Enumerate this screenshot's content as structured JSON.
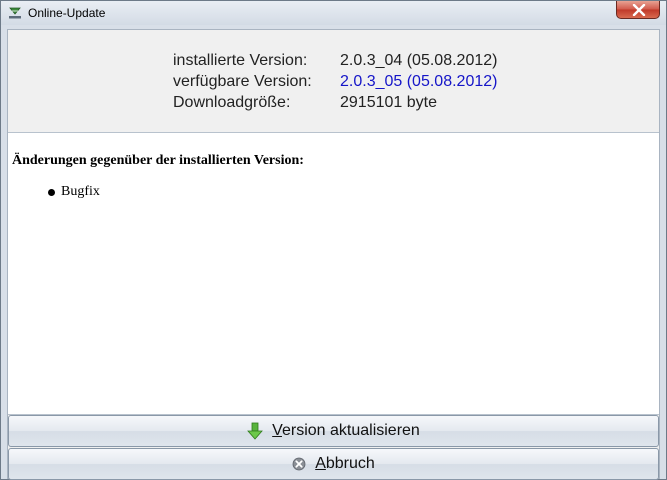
{
  "window": {
    "title": "Online-Update"
  },
  "info": {
    "installed_label": "installierte Version:",
    "installed_value": "2.0.3_04 (05.08.2012)",
    "available_label": "verfügbare Version:",
    "available_value": "2.0.3_05 (05.08.2012)",
    "download_label": "Downloadgröße:",
    "download_value": "2915101 byte"
  },
  "changes": {
    "heading": "Änderungen gegenüber der installierten Version:",
    "items": [
      "Bugfix"
    ]
  },
  "buttons": {
    "update_mnemonic": "V",
    "update_rest": "ersion aktualisieren",
    "cancel_mnemonic": "A",
    "cancel_rest": "bbruch"
  },
  "icons": {
    "app": "download-arrow-icon",
    "close": "close-icon",
    "update": "green-down-arrow-icon",
    "cancel": "cancel-circle-icon"
  },
  "colors": {
    "available_version": "#1515c8",
    "close_button": "#c94a3a"
  }
}
